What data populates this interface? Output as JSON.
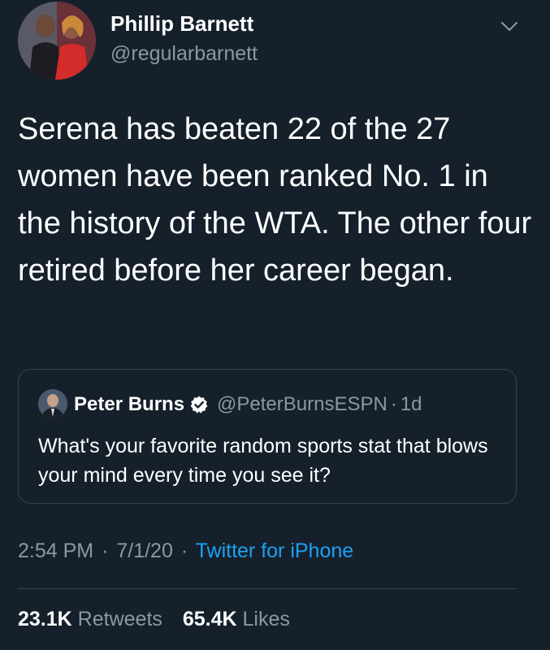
{
  "author": {
    "name": "Phillip Barnett",
    "handle": "@regularbarnett"
  },
  "tweet": {
    "text": "Serena has beaten 22 of the 27 women have been ranked No. 1 in the history of the WTA. The other four retired before her career began."
  },
  "quoted_tweet": {
    "author_name": "Peter Burns",
    "handle": "@PeterBurnsESPN",
    "separator": "·",
    "age": "1d",
    "text": "What's your favorite random sports stat that blows your mind every time you see it?"
  },
  "meta": {
    "time": "2:54 PM",
    "separator": "·",
    "date": "7/1/20",
    "source": "Twitter for iPhone"
  },
  "stats": {
    "retweets_count": "23.1K",
    "retweets_label": "Retweets",
    "likes_count": "65.4K",
    "likes_label": "Likes"
  },
  "colors": {
    "background": "#15202b",
    "primary_text": "#ffffff",
    "secondary_text": "#8899a6",
    "link": "#1da1f2",
    "border": "#38444d"
  },
  "icons": {
    "menu": "chevron-down-icon",
    "verified": "verified-badge-icon"
  }
}
